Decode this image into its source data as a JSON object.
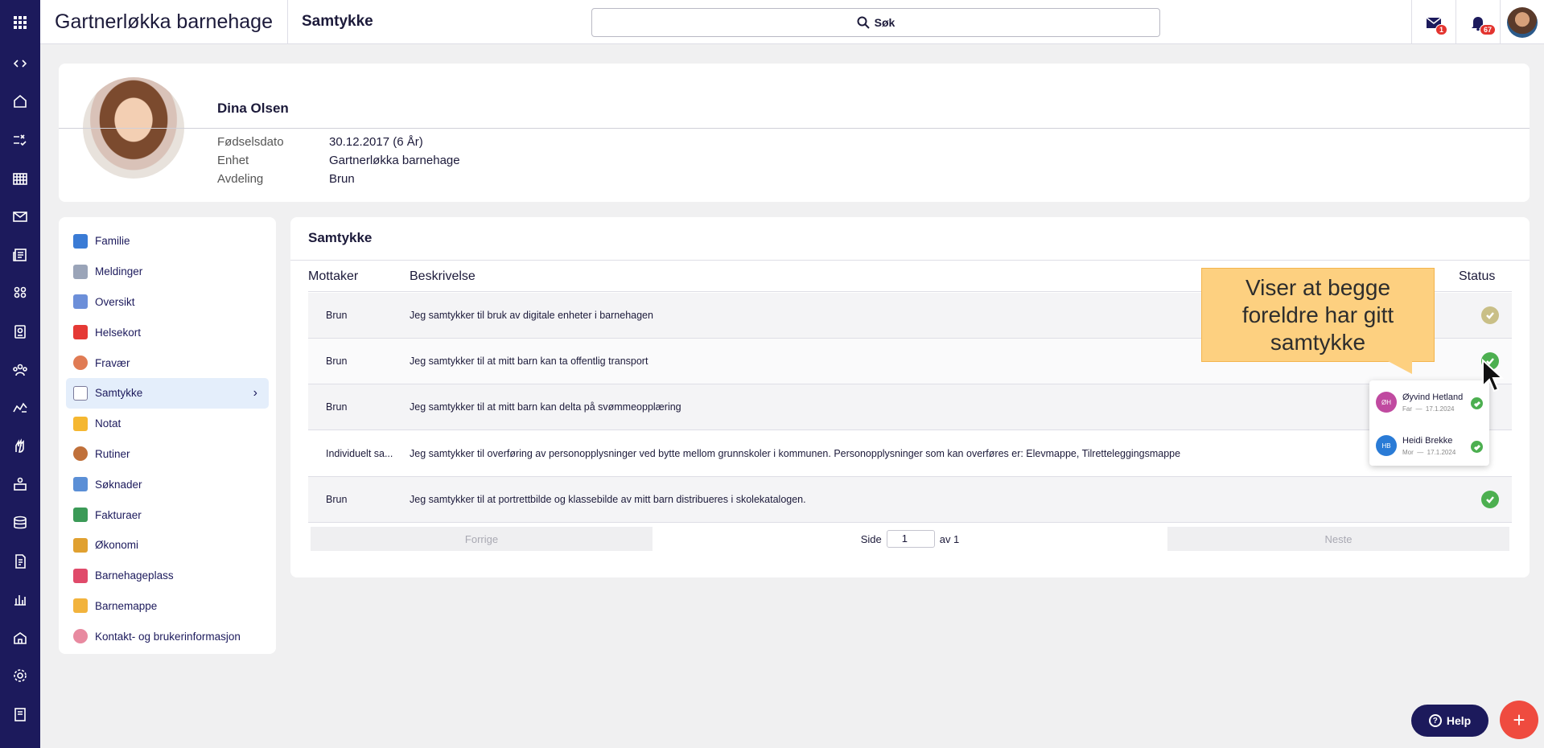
{
  "header": {
    "org_name": "Gartnerløkka barnehage",
    "page_title": "Samtykke",
    "search_label": "Søk",
    "messages_count": "1",
    "notifications_count": "67"
  },
  "profile": {
    "name": "Dina Olsen",
    "fields": [
      {
        "label": "Fødselsdato",
        "value": "30.12.2017 (6 År)"
      },
      {
        "label": "Enhet",
        "value": "Gartnerløkka barnehage"
      },
      {
        "label": "Avdeling",
        "value": "Brun"
      }
    ]
  },
  "menu": {
    "items": [
      {
        "label": "Familie",
        "icon": "family-icon",
        "color": "#3a7bd5"
      },
      {
        "label": "Meldinger",
        "icon": "envelope-icon",
        "color": "#9aa4b8"
      },
      {
        "label": "Oversikt",
        "icon": "overview-icon",
        "color": "#6c8fd9"
      },
      {
        "label": "Helsekort",
        "icon": "health-card-icon",
        "color": "#e53935"
      },
      {
        "label": "Fravær",
        "icon": "absence-icon",
        "color": "#e07b54"
      },
      {
        "label": "Samtykke",
        "icon": "consent-icon",
        "color": "#7a7a9a"
      },
      {
        "label": "Notat",
        "icon": "note-icon",
        "color": "#f5b731"
      },
      {
        "label": "Rutiner",
        "icon": "routines-icon",
        "color": "#c0703a"
      },
      {
        "label": "Søknader",
        "icon": "applications-icon",
        "color": "#5b8fd6"
      },
      {
        "label": "Fakturaer",
        "icon": "invoices-icon",
        "color": "#3b9a57"
      },
      {
        "label": "Økonomi",
        "icon": "economy-icon",
        "color": "#e0a030"
      },
      {
        "label": "Barnehageplass",
        "icon": "kindergarten-place-icon",
        "color": "#e04a6a"
      },
      {
        "label": "Barnemappe",
        "icon": "folder-icon",
        "color": "#f2b33d"
      },
      {
        "label": "Kontakt- og brukerinformasjon",
        "icon": "fingerprint-icon",
        "color": "#e88aa0"
      }
    ],
    "active_index": 5
  },
  "consent": {
    "title": "Samtykke",
    "columns": {
      "recipient": "Mottaker",
      "description": "Beskrivelse",
      "status": "Status"
    },
    "rows": [
      {
        "recipient": "Brun",
        "description": "Jeg samtykker til bruk av digitale enheter i barnehagen",
        "status_color": "#c9bf87"
      },
      {
        "recipient": "Brun",
        "description": "Jeg samtykker til at mitt barn kan ta offentlig transport",
        "status_color": "#4caf50"
      },
      {
        "recipient": "Brun",
        "description": "Jeg samtykker til at mitt barn kan delta på svømmeopplæring",
        "status_color": "#4caf50"
      },
      {
        "recipient": "Individuelt sa...",
        "description": "Jeg samtykker til overføring av personopplysninger ved bytte mellom grunnskoler i kommunen. Personopplysninger som kan overføres er: Elevmappe, Tilretteleggingsmappe",
        "status_color": "#4caf50"
      },
      {
        "recipient": "Brun",
        "description": "Jeg samtykker til at portrettbilde og klassebilde av mitt barn distribueres i skolekatalogen.",
        "status_color": "#4caf50"
      }
    ],
    "pager": {
      "prev": "Forrige",
      "page_label": "Side",
      "page": "1",
      "of_label": "av 1",
      "next": "Neste"
    }
  },
  "callout": {
    "text": "Viser at begge foreldre har gitt samtykke"
  },
  "popover": {
    "guardians": [
      {
        "initials": "ØH",
        "name": "Øyvind Hetland",
        "role": "Far",
        "date": "17.1.2024",
        "color": "#c04aa0"
      },
      {
        "initials": "HB",
        "name": "Heidi Brekke",
        "role": "Mor",
        "date": "17.1.2024",
        "color": "#2a7bd6"
      }
    ]
  },
  "help": {
    "label": "Help"
  }
}
